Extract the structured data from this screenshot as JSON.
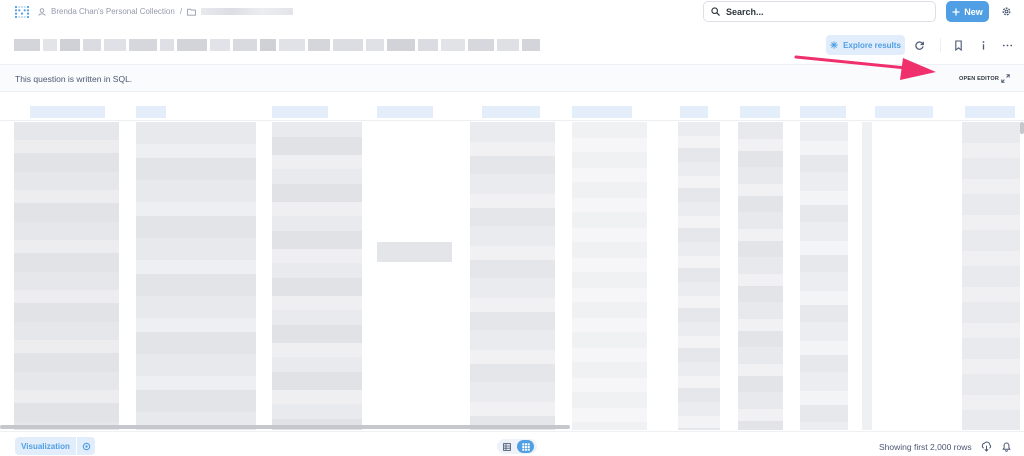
{
  "header": {
    "breadcrumb_collection": "Brenda Chan's Personal Collection",
    "breadcrumb_separator": "/",
    "search_placeholder": "Search...",
    "new_label": "New"
  },
  "toolbar": {
    "explore_label": "Explore results"
  },
  "notice": {
    "message": "This question is written in SQL.",
    "open_editor_label": "OPEN EDITOR"
  },
  "footer": {
    "visualization_label": "Visualization",
    "rows_label": "Showing first 2,000 rows"
  },
  "icons": {
    "logo": "metabase-logo-icon",
    "person": "person-icon",
    "folder": "folder-icon",
    "search": "search-icon",
    "plus": "plus-icon",
    "gear": "gear-icon",
    "explore": "sparkle-icon",
    "refresh": "refresh-icon",
    "bookmark": "bookmark-icon",
    "info": "info-icon",
    "more": "ellipsis-icon",
    "expand": "expand-icon",
    "table_view": "table-icon",
    "grid_view": "grid-icon",
    "download": "download-icon",
    "alert": "bell-icon"
  },
  "colors": {
    "brand": "#509ee3",
    "brand_light": "#e1edfa",
    "annotation_arrow": "#f0306c"
  }
}
